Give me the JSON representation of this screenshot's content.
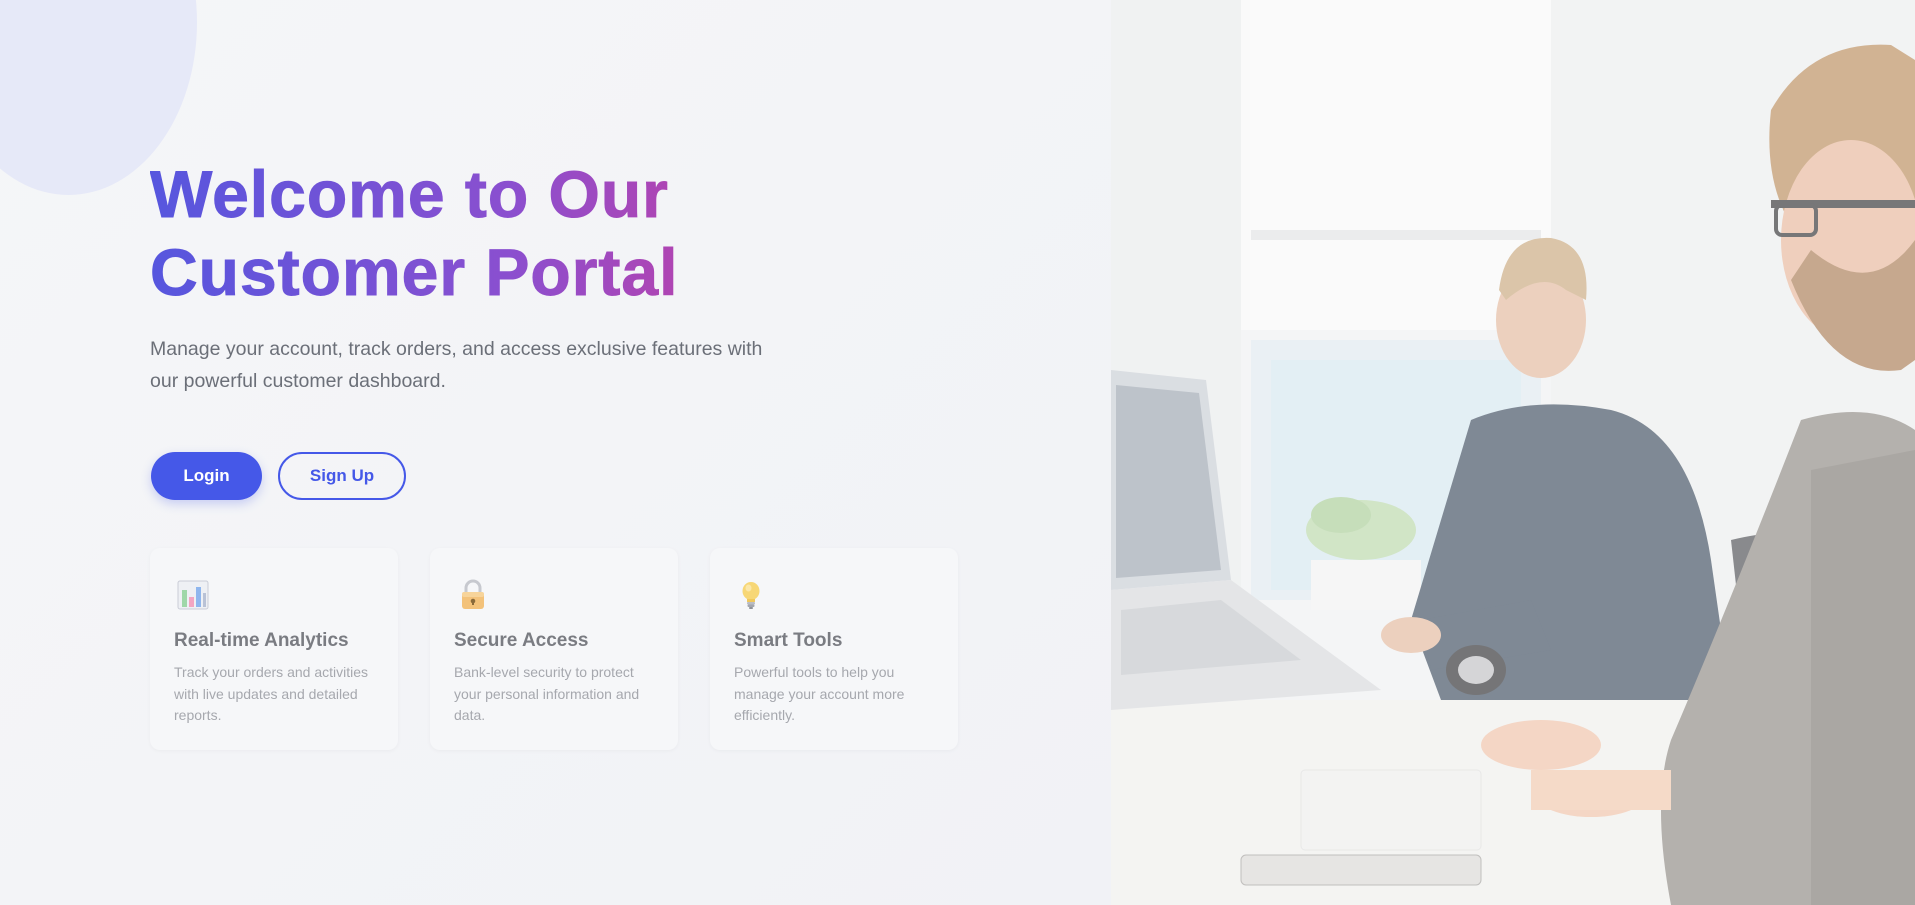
{
  "hero": {
    "headline_line1": "Welcome to Our",
    "headline_line2": "Customer Portal",
    "subtitle": "Manage your account, track orders, and access exclusive features with our powerful customer dashboard."
  },
  "actions": {
    "login_label": "Login",
    "signup_label": "Sign Up"
  },
  "features": [
    {
      "icon": "bar-chart-icon",
      "title": "Real-time Analytics",
      "description": "Track your orders and activities with live updates and detailed reports."
    },
    {
      "icon": "lock-icon",
      "title": "Secure Access",
      "description": "Bank-level security to protect your personal information and data."
    },
    {
      "icon": "lightbulb-icon",
      "title": "Smart Tools",
      "description": "Powerful tools to help you manage your account more efficiently."
    }
  ],
  "colors": {
    "primary": "#4558e8",
    "headline_start": "#5656de",
    "headline_end": "#c23fa4",
    "muted_text": "#6b6f78"
  },
  "hero_image": "office-workers-at-laptops-photo"
}
